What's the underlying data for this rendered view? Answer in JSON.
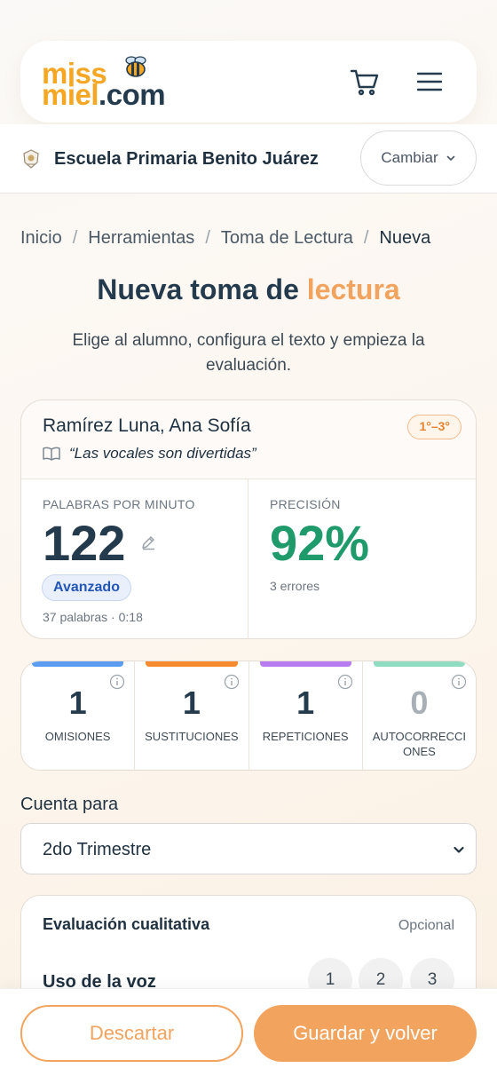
{
  "header": {
    "logo_line1": "miss",
    "logo_line2": "miel",
    "logo_line2_suffix": ".com",
    "cart_icon": "cart-icon",
    "menu_icon": "hamburger-menu-icon"
  },
  "school": {
    "name": "Escuela Primaria Benito Juárez",
    "change_label": "Cambiar"
  },
  "breadcrumb": {
    "items": [
      "Inicio",
      "Herramientas",
      "Toma de Lectura"
    ],
    "current": "Nueva",
    "separator": "/"
  },
  "page": {
    "title_main": "Nueva toma de",
    "title_accent": "lectura",
    "subtitle": "Elige al alumno, configura el texto y empieza la evaluación."
  },
  "student": {
    "name": "Ramírez Luna, Ana Sofía",
    "grade": "1°–3°",
    "book": "“Las vocales son divertidas”"
  },
  "metrics": {
    "wpm_label": "PALABRAS POR MINUTO",
    "wpm_value": "122",
    "level": "Avanzado",
    "meta": "37 palabras · 0:18",
    "accuracy_label": "PRECISIÓN",
    "accuracy_value": "92%",
    "errors": "3 errores"
  },
  "counters": [
    {
      "value": "1",
      "label": "OMISIONES",
      "color": "#5b9cf0"
    },
    {
      "value": "1",
      "label": "SUSTITUCIONES",
      "color": "#f58a2e"
    },
    {
      "value": "1",
      "label": "REPETICIONES",
      "color": "#b77cf0"
    },
    {
      "value": "0",
      "label": "AUTOCORRECCIONES",
      "color": "#8fdcc0"
    }
  ],
  "cuenta": {
    "label": "Cuenta para",
    "selected": "2do Trimestre"
  },
  "qualitative": {
    "title": "Evaluación cualitativa",
    "optional": "Opcional",
    "row_label": "Uso de la voz",
    "options": [
      "1",
      "2",
      "3"
    ]
  },
  "actions": {
    "discard": "Descartar",
    "save": "Guardar y volver"
  },
  "colors": {
    "accent": "#f2a35e",
    "brand_yellow": "#f5a623",
    "navy": "#243a4d",
    "success": "#1f9a6a"
  }
}
